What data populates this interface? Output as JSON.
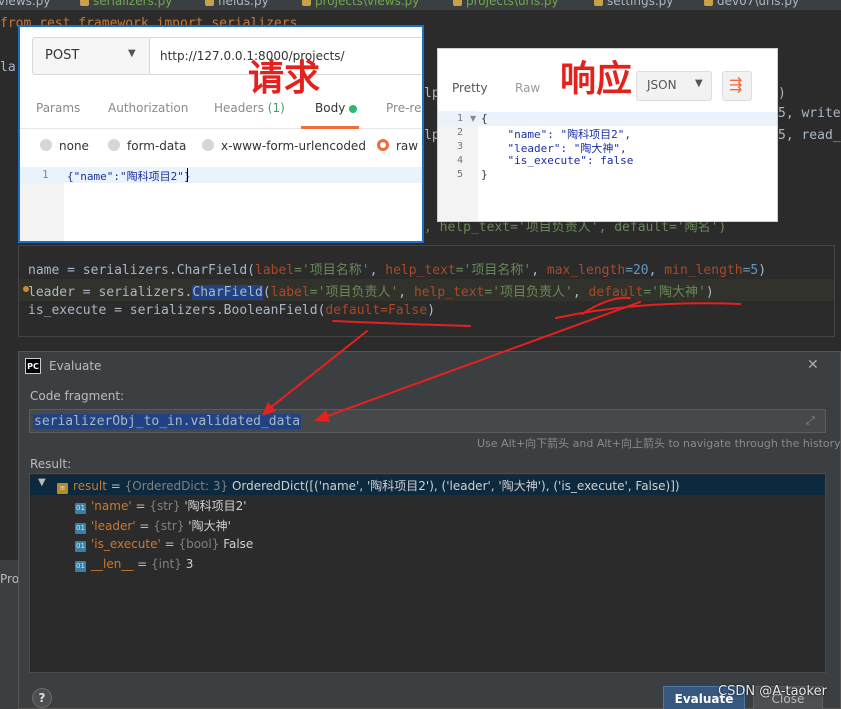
{
  "editor_tabs": [
    "views.py",
    "serializers.py",
    "fields.py",
    "projects\\views.py",
    "projects\\urls.py",
    "settings.py",
    "dev07\\urls.py"
  ],
  "background_code": {
    "line1": "from rest_framework import serializers",
    "partial_la": "la",
    "partial_lp1": "lp",
    "partial_lp2": "lp",
    "partial_write": "5, write",
    "partial_read": "5, read_",
    "partial_paren": ")",
    "partial_help": ", help_text='项目负责人', default='陶名')"
  },
  "request": {
    "method": "POST",
    "url": "http://127.0.0.1:8000/projects/",
    "tabs": [
      {
        "label": "Params"
      },
      {
        "label": "Authorization"
      },
      {
        "label": "Headers",
        "count": "(1)"
      },
      {
        "label": "Body"
      },
      {
        "label": "Pre-re"
      }
    ],
    "body_types": [
      "none",
      "form-data",
      "x-www-form-urlencoded",
      "raw"
    ],
    "editor_line_number": "1",
    "editor_text": "{\"name\":\"陶科项目2\"}",
    "annotation": "请求"
  },
  "response": {
    "tabs": [
      "Pretty",
      "Raw"
    ],
    "format": "JSON",
    "annotation": "响应",
    "line_numbers": [
      "1",
      "2",
      "3",
      "4",
      "5"
    ],
    "lines": [
      "{",
      "    \"name\": \"陶科项目2\",",
      "    \"leader\": \"陶大神\",",
      "    \"is_execute\": false",
      "}"
    ]
  },
  "code": {
    "line1": {
      "a": "name = serializers.",
      "cls": "CharField",
      "b": "(",
      "kw1": "label",
      "s1": "='项目名称'",
      "c1": ", ",
      "kw2": "help_text",
      "s2": "='项目名称'",
      "c2": ", ",
      "kw3": "max_length",
      "n1": "=20",
      "c3": ", ",
      "kw4": "min_length",
      "n2": "=5",
      "e": ")"
    },
    "line2": {
      "a": "leader = serializers.",
      "cls": "CharField",
      "b": "(",
      "kw1": "label",
      "s1": "='项目负责人'",
      "c1": ", ",
      "kw2": "help_text",
      "s2": "='项目负责人'",
      "c2": ", ",
      "kw3": "default",
      "s3": "='陶大神'",
      "e": ")"
    },
    "line3": {
      "a": "is_execute = serializers.BooleanField(",
      "kw1": "default",
      "s1": "=False",
      "e": ")"
    }
  },
  "evaluate": {
    "title": "Evaluate",
    "code_fragment_label": "Code fragment:",
    "code_fragment": "serializerObj_to_in.validated_data",
    "hint": "Use Alt+向下箭头 and Alt+向上箭头 to navigate through the history",
    "result_label": "Result:",
    "result_root": {
      "name": "result",
      "type": "{OrderedDict: 3}",
      "value": "OrderedDict([('name', '陶科项目2'), ('leader', '陶大神'), ('is_execute', False)])"
    },
    "children": [
      {
        "name": "'name'",
        "type": "{str}",
        "value": "'陶科项目2'"
      },
      {
        "name": "'leader'",
        "type": "{str}",
        "value": "'陶大神'"
      },
      {
        "name": "'is_execute'",
        "type": "{bool}",
        "value": "False"
      },
      {
        "name": "__len__",
        "type": "{int}",
        "value": "3"
      }
    ],
    "evaluate_button": "Evaluate",
    "close_button": "Close",
    "help": "?"
  },
  "side_text": "Pro",
  "watermark": "CSDN @A-taoker",
  "colors": {
    "annotation_red": "#e5211d",
    "postman_orange": "#f26b3a",
    "ide_bg": "#2b2b2b",
    "selection": "#214283"
  }
}
